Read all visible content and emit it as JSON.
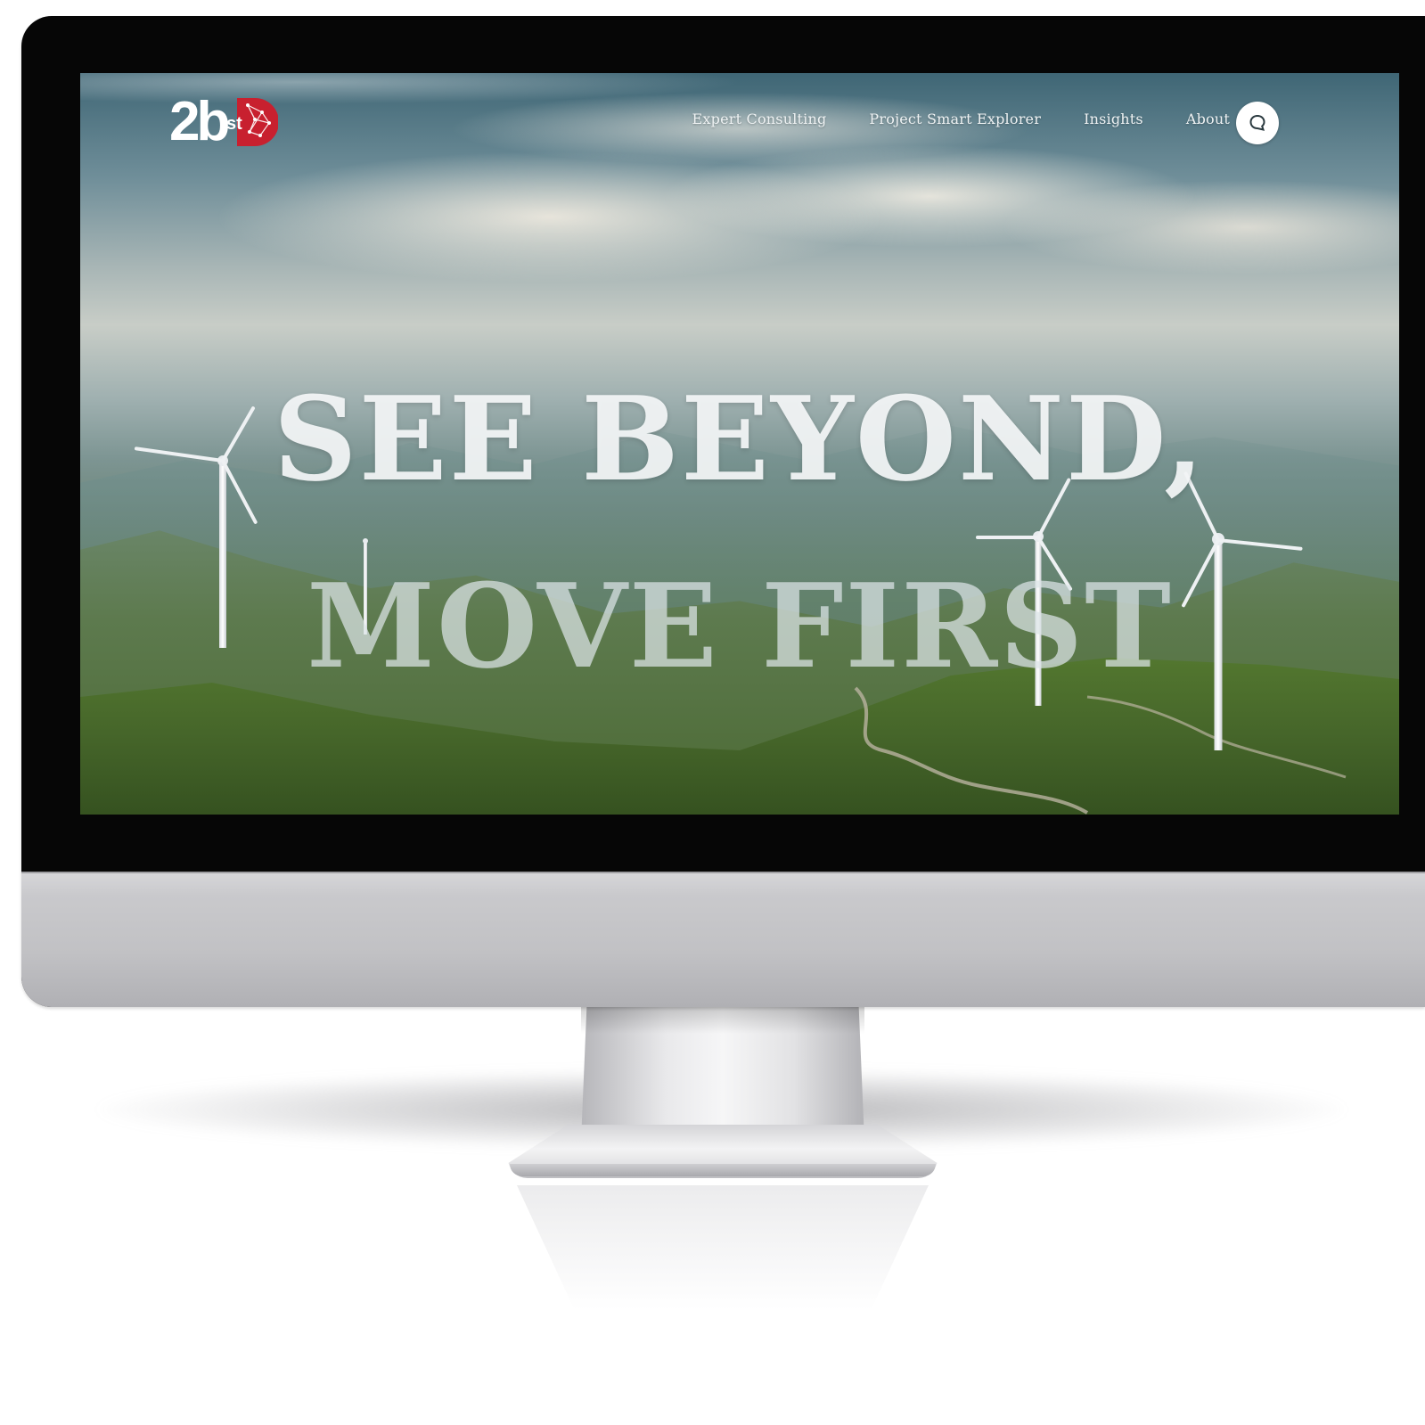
{
  "brand": {
    "logo_text": "2b",
    "logo_sup": "st",
    "accent_color": "#c8202f"
  },
  "nav": {
    "links": [
      {
        "label": "Expert Consulting"
      },
      {
        "label": "Project Smart Explorer"
      },
      {
        "label": "Insights"
      },
      {
        "label": "About"
      }
    ],
    "chat_icon": "chat-bubble-icon"
  },
  "hero": {
    "line1": "SEE BEYOND,",
    "line2": "MOVE FIRST"
  },
  "device": {
    "type": "desktop-monitor",
    "bezel_color": "#060606",
    "body_color": "#c4c4c7"
  }
}
